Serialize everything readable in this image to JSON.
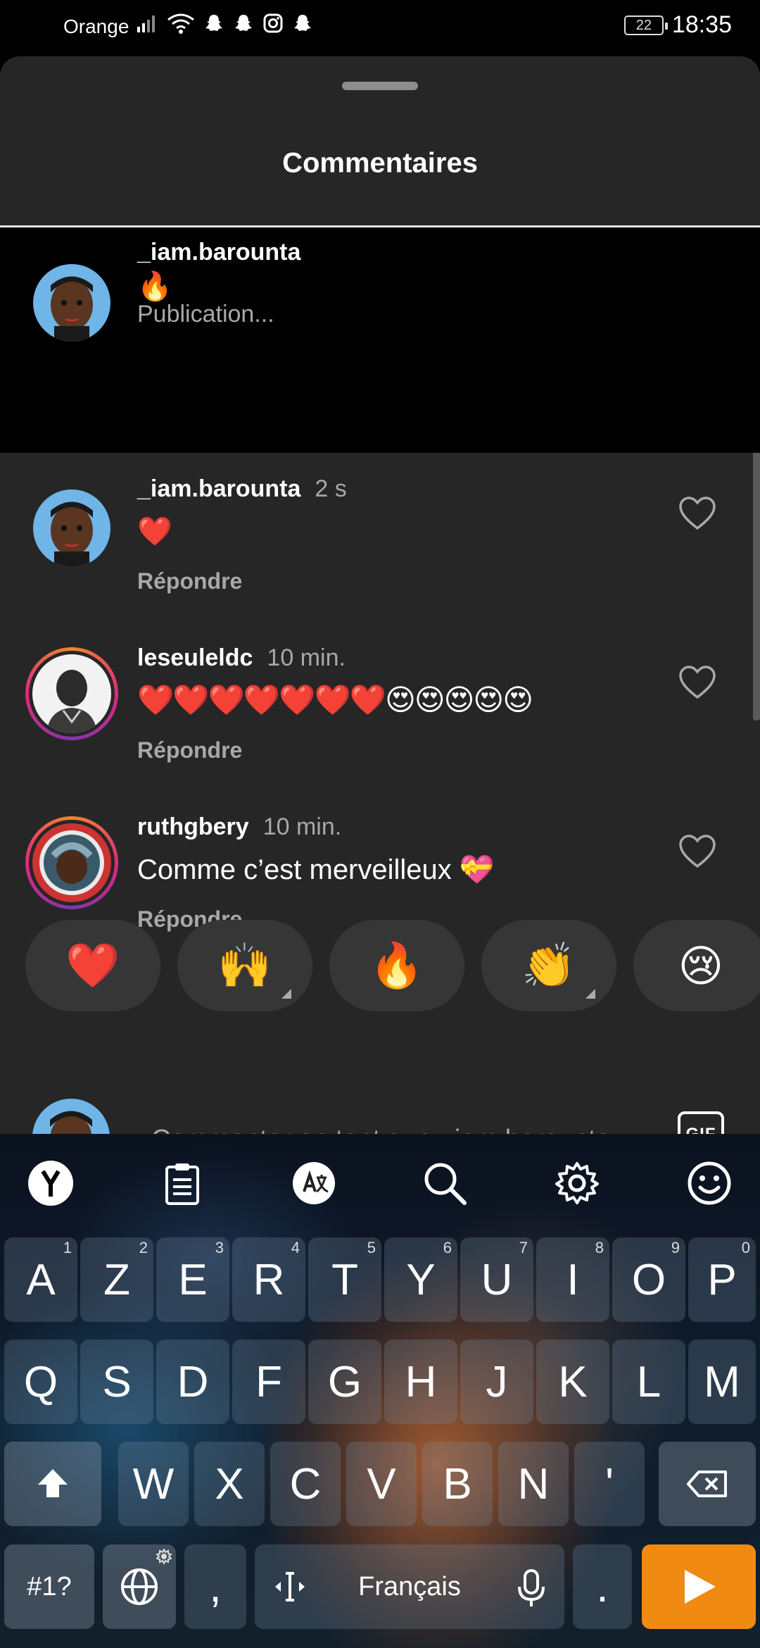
{
  "status_bar": {
    "carrier": "Orange",
    "battery": "22",
    "time": "18:35"
  },
  "sheet": {
    "title": "Commentaires"
  },
  "comments": [
    {
      "user": "_iam.barounta",
      "time": "",
      "text": "🔥",
      "status": "Publication...",
      "avatar_icon": "user-avatar-icon"
    },
    {
      "user": "_iam.barounta",
      "time": "2 s",
      "text": "❤️",
      "reply": "Répondre",
      "avatar_icon": "user-avatar-icon"
    },
    {
      "user": "leseuleldc",
      "time": "10 min.",
      "text": "❤️❤️❤️❤️❤️❤️❤️😍😍😍😍😍",
      "reply": "Répondre",
      "avatar_icon": "user-avatar-icon"
    },
    {
      "user": "ruthgbery",
      "time": "10 min.",
      "text": "Comme c’est merveilleux 💝",
      "reply": "Répondre",
      "avatar_icon": "user-avatar-icon"
    }
  ],
  "reactions": [
    "❤️",
    "🙌",
    "🔥",
    "👏",
    "😢"
  ],
  "input": {
    "placeholder": "Commenter en tant que _iam.barounta",
    "gif_label": "GIF"
  },
  "keyboard": {
    "row1": [
      {
        "k": "A",
        "n": "1"
      },
      {
        "k": "Z",
        "n": "2"
      },
      {
        "k": "E",
        "n": "3"
      },
      {
        "k": "R",
        "n": "4"
      },
      {
        "k": "T",
        "n": "5"
      },
      {
        "k": "Y",
        "n": "6"
      },
      {
        "k": "U",
        "n": "7"
      },
      {
        "k": "I",
        "n": "8"
      },
      {
        "k": "O",
        "n": "9"
      },
      {
        "k": "P",
        "n": "0"
      }
    ],
    "row2": [
      "Q",
      "S",
      "D",
      "F",
      "G",
      "H",
      "J",
      "K",
      "L",
      "M"
    ],
    "row3": [
      "W",
      "X",
      "C",
      "V",
      "B",
      "N",
      "'"
    ],
    "symbols": "#1?",
    "comma": ",",
    "space": "Français",
    "period": ".",
    "accent": "#f08a12"
  }
}
